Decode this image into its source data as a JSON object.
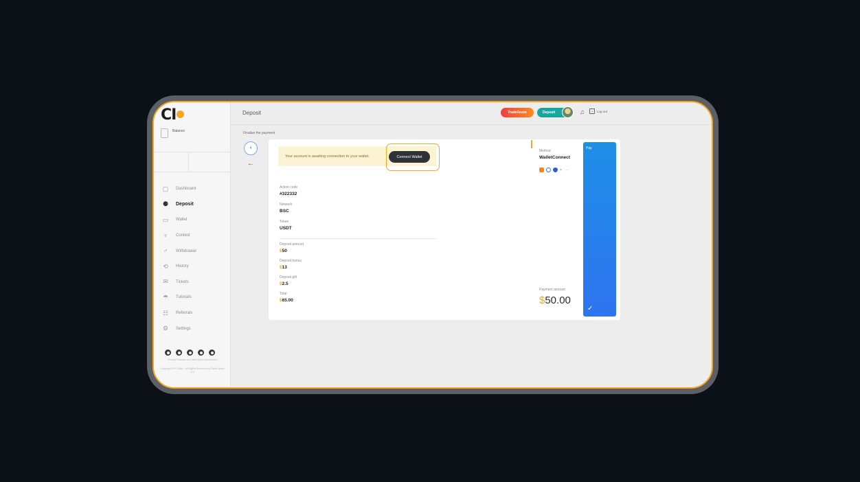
{
  "app": {
    "logo_text": "CI",
    "page_title": "Deposit"
  },
  "header": {
    "traderoom_label": "TradeRoom",
    "deposit_label": "Deposit",
    "logout_label": "Log out"
  },
  "sidebar": {
    "balance_label": "Balance",
    "items": [
      {
        "label": "Dashboard",
        "icon": "dashboard-icon",
        "active": false
      },
      {
        "label": "Deposit",
        "icon": "deposit-icon",
        "active": true
      },
      {
        "label": "Wallet",
        "icon": "wallet-icon",
        "active": false
      },
      {
        "label": "Contest",
        "icon": "trophy-icon",
        "active": false
      },
      {
        "label": "Withdrawal",
        "icon": "withdrawal-icon",
        "active": false
      },
      {
        "label": "History",
        "icon": "history-icon",
        "active": false
      },
      {
        "label": "Tickets",
        "icon": "tickets-icon",
        "active": false
      },
      {
        "label": "Tutorials",
        "icon": "tutorials-icon",
        "active": false
      },
      {
        "label": "Referrals",
        "icon": "referrals-icon",
        "active": false
      },
      {
        "label": "Settings",
        "icon": "settings-icon",
        "active": false
      }
    ],
    "footer_powered": "Proudly Powered by ClaimOption Developers",
    "footer_copyright": "Copyright 20** Claim - All Rights Reserved by ClaimOption LLC"
  },
  "main": {
    "breadcrumb": "Finalize the payment",
    "step_number": "4",
    "notice": "Your account is awaiting connection to your wallet.",
    "connect_label": "Connect Wallet",
    "fields": {
      "action_code_label": "Action code",
      "action_code_value": "#322332",
      "network_label": "Network",
      "network_value": "BSC",
      "token_label": "Token",
      "token_value": "USDT",
      "deposit_amount_label": "Deposit amount",
      "deposit_amount_value": "50",
      "deposit_bonus_label": "Deposit bonus",
      "deposit_bonus_value": "13",
      "deposit_gift_label": "Deposit gift",
      "deposit_gift_value": "2.5",
      "total_label": "Total",
      "total_value": "65.00",
      "currency_symbol": "$"
    },
    "method_label": "Method",
    "method_value": "WalletConnect",
    "payment_label": "Payment amount",
    "payment_value": "50.00",
    "pay_label": "Pay"
  },
  "colors": {
    "accent": "#f5a623",
    "pay_blue": "#2f74f0",
    "deposit_teal": "#17a7a0"
  }
}
